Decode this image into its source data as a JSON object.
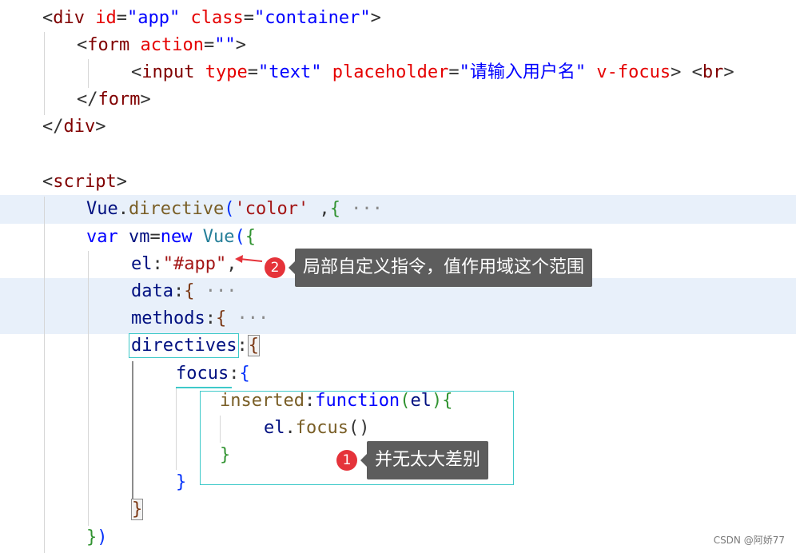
{
  "code": {
    "l1": {
      "lt": "<",
      "tag": "div",
      "a1": " id",
      "eq1": "=",
      "v1": "\"app\"",
      "a2": " class",
      "eq2": "=",
      "v2": "\"container\"",
      "gt": ">"
    },
    "l2": {
      "lt": "<",
      "tag": "form",
      "a1": " action",
      "eq1": "=",
      "v1": "\"\"",
      "gt": ">"
    },
    "l3": {
      "lt": "<",
      "tag": "input",
      "a1": " type",
      "eq1": "=",
      "v1": "\"text\"",
      "a2": " placeholder",
      "eq2": "=",
      "v2": "\"请输入用户名\"",
      "a3": " v-focus",
      "gt": ">",
      "lt2": " <",
      "tag2": "br",
      "gt2": ">"
    },
    "l4": {
      "lt": "</",
      "tag": "form",
      "gt": ">"
    },
    "l5": {
      "lt": "</",
      "tag": "div",
      "gt": ">"
    },
    "l6": {
      "lt": "<",
      "tag": "script",
      "gt": ">"
    },
    "l7": {
      "obj": "Vue",
      "dot": ".",
      "fn": "directive",
      "open": "(",
      "str": "'color'",
      "comma": " ,",
      "brace": "{",
      "fold": " ···"
    },
    "l8": {
      "kw1": "var",
      "var": " vm",
      "eq": "=",
      "kw2": "new",
      "cls": " Vue",
      "open": "(",
      "brace": "{"
    },
    "l9": {
      "prop": "el",
      "colon": ":",
      "str": "\"#app\"",
      "comma": ","
    },
    "l10": {
      "prop": "data",
      "colon": ":",
      "brace": "{",
      "fold": " ···"
    },
    "l11": {
      "prop": "methods",
      "colon": ":",
      "brace": "{",
      "fold": " ···"
    },
    "l12": {
      "prop": "directives",
      "colon": ":",
      "brace": "{"
    },
    "l13": {
      "prop": "focus",
      "colon": ":",
      "brace": "{"
    },
    "l14": {
      "prop": "inserted",
      "colon": ":",
      "kw": "function",
      "open": "(",
      "param": "el",
      "close": ")",
      "brace": "{"
    },
    "l15": {
      "obj": "el",
      "dot": ".",
      "fn": "focus",
      "parens": "()"
    },
    "l16": {
      "brace": "}"
    },
    "l17": {
      "brace": "}"
    },
    "l18": {
      "brace": "}"
    },
    "l19": {
      "brace": "}",
      "paren": ")"
    }
  },
  "annotations": [
    {
      "number": "1",
      "text": "并无太大差别"
    },
    {
      "number": "2",
      "text": "局部自定义指令，值作用域这个范围"
    }
  ],
  "watermark": "CSDN @阿娇77",
  "colors": {
    "callout_bg": "#5d5d5d",
    "badge": "#e5333a",
    "selection_border": "#3ec9c9",
    "fold_highlight": "#e8f0fa"
  }
}
